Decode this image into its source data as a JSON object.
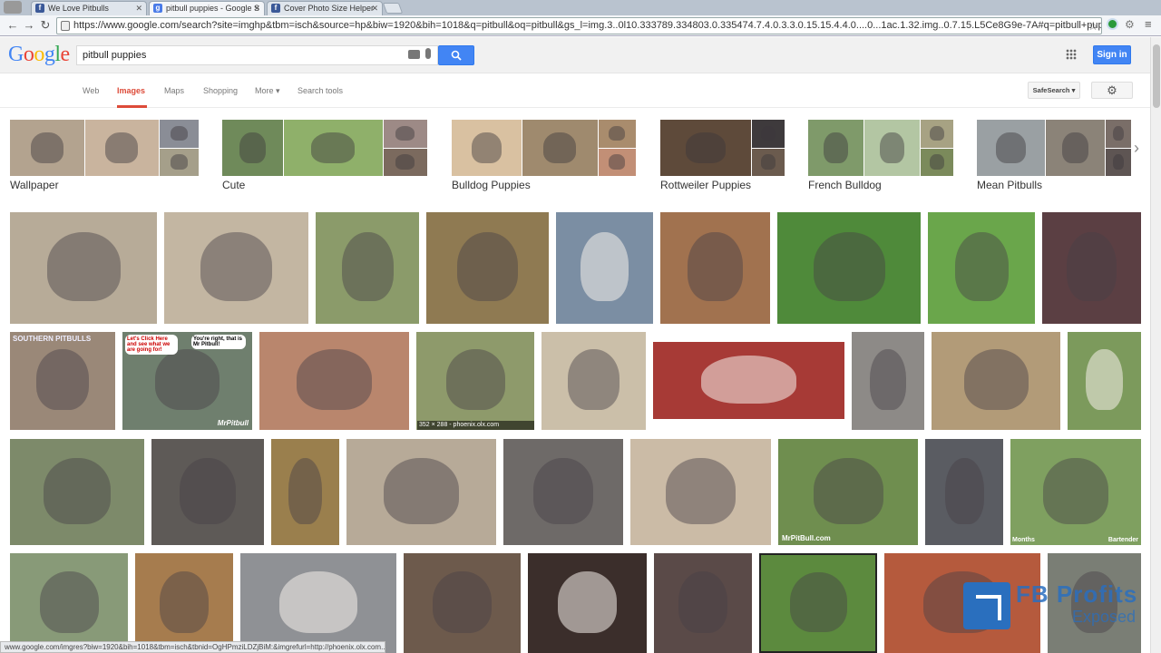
{
  "browser": {
    "tabs": [
      {
        "title": "We Love Pitbulls",
        "favicon": "facebook-icon"
      },
      {
        "title": "pitbull puppies - Google S",
        "favicon": "google-icon"
      },
      {
        "title": "Cover Photo Size Helper",
        "favicon": "facebook-icon"
      }
    ],
    "url": "https://www.google.com/search?site=imghp&tbm=isch&source=hp&biw=1920&bih=1018&q=pitbull&oq=pitbull&gs_l=img.3..0l10.333789.334803.0.335474.7.4.0.3.3.0.15.15.4.4.0....0...1ac.1.32.img..0.7.15.L5Ce8G9e-7A#q=pitbull+puppies&",
    "status_url": "www.google.com/imgres?biw=1920&bih=1018&tbm=isch&tbnid=OgHPmziLDZjBiM:&imgrefurl=http://phoenix.olx.com..."
  },
  "google": {
    "logo": "Google",
    "search_query": "pitbull puppies",
    "search_button": "🔍",
    "signin_label": "Sign in",
    "nav": [
      "Web",
      "Images",
      "Maps",
      "Shopping",
      "More ▾",
      "Search tools"
    ],
    "safesearch_label": "SafeSearch ▾",
    "settings_icon": "gear-icon"
  },
  "related_searches": [
    {
      "label": "Wallpaper"
    },
    {
      "label": "Cute"
    },
    {
      "label": "Bulldog Puppies"
    },
    {
      "label": "Rottweiler Puppies"
    },
    {
      "label": "French Bulldog"
    },
    {
      "label": "Mean Pitbulls"
    }
  ],
  "image_caption": "352 × 288 - phoenix.olx.com",
  "image_overlays": {
    "southern": "SOUTHERN PITBULLS",
    "bubble1": "Let's Click Here and see what we are going for!",
    "bubble2": "You're right, that is Mr Pitbull!",
    "mrpitbull": "MrPitbull",
    "mrpitbull_com": "MrPitBull.com",
    "months": "Months",
    "bartender": "Bartender"
  },
  "watermark": {
    "line1": "FB Profits",
    "line2": "Exposed"
  },
  "colors": {
    "google_blue": "#4285f4",
    "active_tab_red": "#dd4b39"
  }
}
